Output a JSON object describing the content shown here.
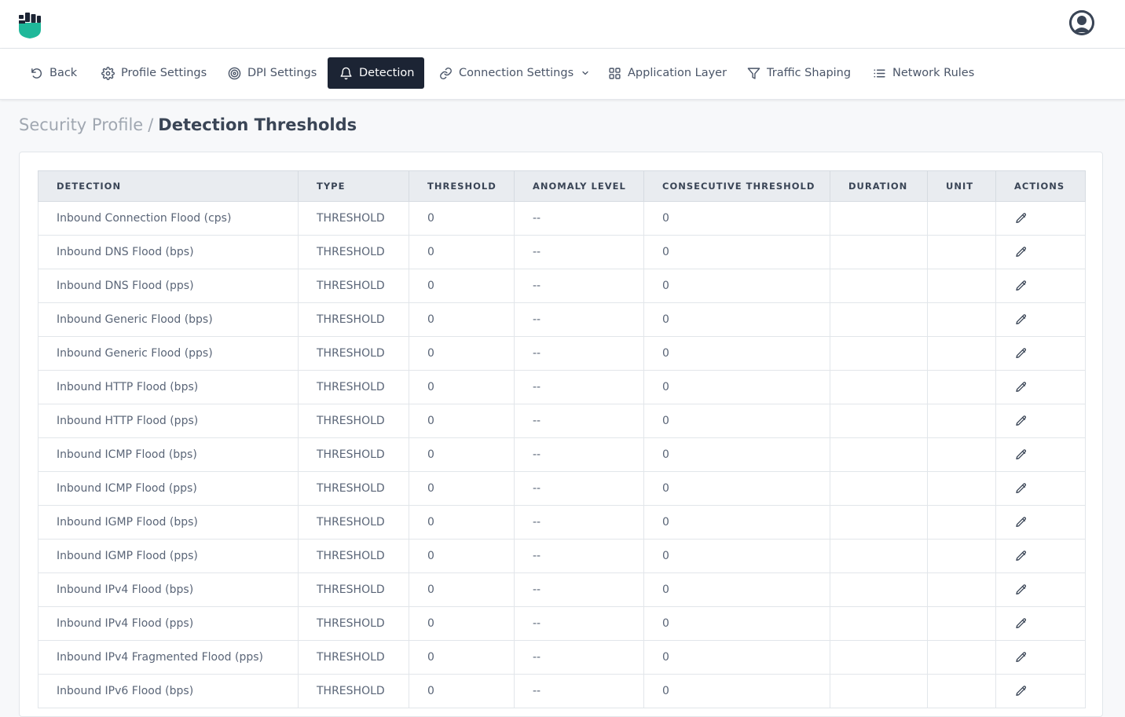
{
  "header": {
    "logo_icon": "fist-shield-logo",
    "avatar_icon": "user-avatar-icon"
  },
  "nav": {
    "items": [
      {
        "label": "Back",
        "icon": "undo-icon"
      },
      {
        "label": "Profile Settings",
        "icon": "gear-icon"
      },
      {
        "label": "DPI Settings",
        "icon": "target-icon"
      },
      {
        "label": "Detection",
        "icon": "bell-icon",
        "active": true
      },
      {
        "label": "Connection Settings",
        "icon": "link-icon",
        "has_dropdown": true
      },
      {
        "label": "Application Layer",
        "icon": "grid-icon"
      },
      {
        "label": "Traffic Shaping",
        "icon": "filter-icon"
      },
      {
        "label": "Network Rules",
        "icon": "list-icon"
      }
    ]
  },
  "breadcrumb": {
    "parent": "Security Profile",
    "separator": "/",
    "current": "Detection Thresholds"
  },
  "table": {
    "columns": [
      "DETECTION",
      "TYPE",
      "THRESHOLD",
      "ANOMALY LEVEL",
      "CONSECUTIVE THRESHOLD",
      "DURATION",
      "UNIT",
      "ACTIONS"
    ],
    "rows": [
      {
        "detection": "Inbound Connection Flood (cps)",
        "type": "THRESHOLD",
        "threshold": "0",
        "anomaly_level": "--",
        "consecutive_threshold": "0",
        "duration": "",
        "unit": ""
      },
      {
        "detection": "Inbound DNS Flood (bps)",
        "type": "THRESHOLD",
        "threshold": "0",
        "anomaly_level": "--",
        "consecutive_threshold": "0",
        "duration": "",
        "unit": ""
      },
      {
        "detection": "Inbound DNS Flood (pps)",
        "type": "THRESHOLD",
        "threshold": "0",
        "anomaly_level": "--",
        "consecutive_threshold": "0",
        "duration": "",
        "unit": ""
      },
      {
        "detection": "Inbound Generic Flood (bps)",
        "type": "THRESHOLD",
        "threshold": "0",
        "anomaly_level": "--",
        "consecutive_threshold": "0",
        "duration": "",
        "unit": ""
      },
      {
        "detection": "Inbound Generic Flood (pps)",
        "type": "THRESHOLD",
        "threshold": "0",
        "anomaly_level": "--",
        "consecutive_threshold": "0",
        "duration": "",
        "unit": ""
      },
      {
        "detection": "Inbound HTTP Flood (bps)",
        "type": "THRESHOLD",
        "threshold": "0",
        "anomaly_level": "--",
        "consecutive_threshold": "0",
        "duration": "",
        "unit": ""
      },
      {
        "detection": "Inbound HTTP Flood (pps)",
        "type": "THRESHOLD",
        "threshold": "0",
        "anomaly_level": "--",
        "consecutive_threshold": "0",
        "duration": "",
        "unit": ""
      },
      {
        "detection": "Inbound ICMP Flood (bps)",
        "type": "THRESHOLD",
        "threshold": "0",
        "anomaly_level": "--",
        "consecutive_threshold": "0",
        "duration": "",
        "unit": ""
      },
      {
        "detection": "Inbound ICMP Flood (pps)",
        "type": "THRESHOLD",
        "threshold": "0",
        "anomaly_level": "--",
        "consecutive_threshold": "0",
        "duration": "",
        "unit": ""
      },
      {
        "detection": "Inbound IGMP Flood (bps)",
        "type": "THRESHOLD",
        "threshold": "0",
        "anomaly_level": "--",
        "consecutive_threshold": "0",
        "duration": "",
        "unit": ""
      },
      {
        "detection": "Inbound IGMP Flood (pps)",
        "type": "THRESHOLD",
        "threshold": "0",
        "anomaly_level": "--",
        "consecutive_threshold": "0",
        "duration": "",
        "unit": ""
      },
      {
        "detection": "Inbound IPv4 Flood (bps)",
        "type": "THRESHOLD",
        "threshold": "0",
        "anomaly_level": "--",
        "consecutive_threshold": "0",
        "duration": "",
        "unit": ""
      },
      {
        "detection": "Inbound IPv4 Flood (pps)",
        "type": "THRESHOLD",
        "threshold": "0",
        "anomaly_level": "--",
        "consecutive_threshold": "0",
        "duration": "",
        "unit": ""
      },
      {
        "detection": "Inbound IPv4 Fragmented Flood (pps)",
        "type": "THRESHOLD",
        "threshold": "0",
        "anomaly_level": "--",
        "consecutive_threshold": "0",
        "duration": "",
        "unit": ""
      },
      {
        "detection": "Inbound IPv6 Flood (bps)",
        "type": "THRESHOLD",
        "threshold": "0",
        "anomaly_level": "--",
        "consecutive_threshold": "0",
        "duration": "",
        "unit": ""
      }
    ],
    "row_action_icon": "pencil-icon"
  },
  "colors": {
    "active_nav_bg": "#1c2434",
    "logo_green": "#1fb89a",
    "logo_dark": "#1c2434",
    "header_bg": "#e9ecf0"
  }
}
